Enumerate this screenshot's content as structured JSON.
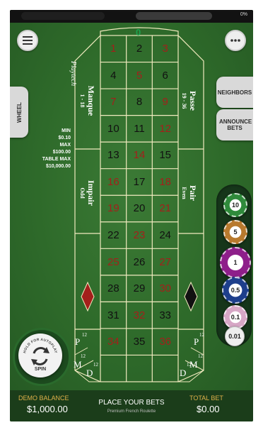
{
  "statusbar": {
    "battery": "0%"
  },
  "controls": {
    "menu_icon": "hamburger-icon",
    "more_icon": "ellipsis-icon",
    "wheel_label": "WHEEL",
    "neighbors_label": "NEIGHBORS",
    "announce_bets_label": "ANNOUNCE BETS"
  },
  "brand": "Playtech",
  "limits": {
    "min_label": "MIN",
    "min_value": "$0.10",
    "max_label": "MAX",
    "max_value": "$100.00",
    "table_max_label": "TABLE MAX",
    "table_max_value": "$10,000.00"
  },
  "table": {
    "zero": "0",
    "numbers": [
      {
        "n": "1",
        "c": "red"
      },
      {
        "n": "2",
        "c": "black"
      },
      {
        "n": "3",
        "c": "red"
      },
      {
        "n": "4",
        "c": "black"
      },
      {
        "n": "5",
        "c": "red"
      },
      {
        "n": "6",
        "c": "black"
      },
      {
        "n": "7",
        "c": "red"
      },
      {
        "n": "8",
        "c": "black"
      },
      {
        "n": "9",
        "c": "red"
      },
      {
        "n": "10",
        "c": "black"
      },
      {
        "n": "11",
        "c": "black"
      },
      {
        "n": "12",
        "c": "red"
      },
      {
        "n": "13",
        "c": "black"
      },
      {
        "n": "14",
        "c": "red"
      },
      {
        "n": "15",
        "c": "black"
      },
      {
        "n": "16",
        "c": "red"
      },
      {
        "n": "17",
        "c": "black"
      },
      {
        "n": "18",
        "c": "red"
      },
      {
        "n": "19",
        "c": "red"
      },
      {
        "n": "20",
        "c": "black"
      },
      {
        "n": "21",
        "c": "red"
      },
      {
        "n": "22",
        "c": "black"
      },
      {
        "n": "23",
        "c": "red"
      },
      {
        "n": "24",
        "c": "black"
      },
      {
        "n": "25",
        "c": "red"
      },
      {
        "n": "26",
        "c": "black"
      },
      {
        "n": "27",
        "c": "red"
      },
      {
        "n": "28",
        "c": "black"
      },
      {
        "n": "29",
        "c": "black"
      },
      {
        "n": "30",
        "c": "red"
      },
      {
        "n": "31",
        "c": "black"
      },
      {
        "n": "32",
        "c": "red"
      },
      {
        "n": "33",
        "c": "black"
      },
      {
        "n": "34",
        "c": "red"
      },
      {
        "n": "35",
        "c": "black"
      },
      {
        "n": "36",
        "c": "red"
      }
    ],
    "manque": "Manque",
    "manque_range": "1 - 18",
    "passe": "Passe",
    "passe_range": "19 - 36",
    "impair": "Impair",
    "impair_sub": "Odd",
    "pair": "Pair",
    "pair_sub": "Even",
    "dozen_left": {
      "p": "P",
      "m": "M",
      "d": "D",
      "n": "12"
    },
    "dozen_right": {
      "p": "P",
      "m": "M",
      "d": "D",
      "n": "12"
    }
  },
  "chips": [
    {
      "value": "10",
      "color": "#2f8a3b"
    },
    {
      "value": "5",
      "color": "#b87a2e"
    },
    {
      "value": "1",
      "color": "#8e1f8a"
    },
    {
      "value": "0.5",
      "color": "#1e3f8c"
    },
    {
      "value": "0.1",
      "color": "#d7a7c6"
    },
    {
      "value": "0.01",
      "color": "#e9e9e9"
    }
  ],
  "spin_button": {
    "hold_text": "HOLD FOR AUTOPLAY",
    "label": "SPIN"
  },
  "bottom": {
    "balance_label": "DEMO BALANCE",
    "balance_value": "$1,000.00",
    "message": "PLACE YOUR BETS",
    "game_name": "Premium French Roulette",
    "total_label": "TOTAL BET",
    "total_value": "$0.00"
  },
  "colors": {
    "felt": "#2f6b2c",
    "red": "#a3201b",
    "gold": "#e0b14a",
    "zero_green": "#1da350"
  }
}
